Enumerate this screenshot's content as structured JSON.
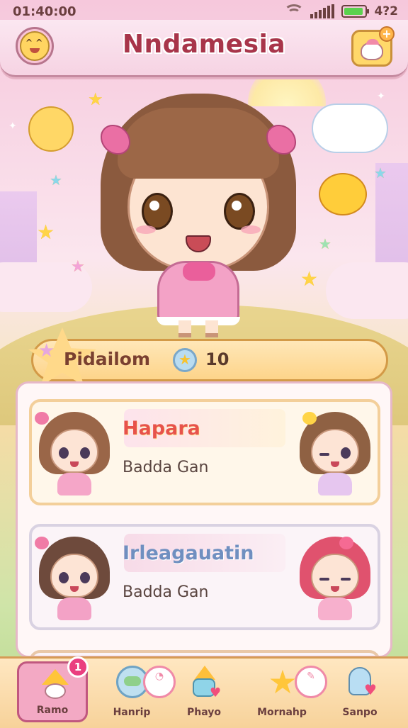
{
  "status_bar": {
    "time": "01:40:00",
    "battery_text": "4?2",
    "battery_level": 0.9
  },
  "header": {
    "title": "Nndamesia",
    "left_icon": "mascot-avatar-icon",
    "right_icon": "mascot-shop-icon"
  },
  "banner": {
    "label": "Pidailom",
    "currency_icon": "star-coin-icon",
    "currency_value": "10"
  },
  "cards": [
    {
      "title": "Hapara",
      "subtitle": "Badda Gan"
    },
    {
      "title": "Irleagauatin",
      "subtitle": "Badda Gan"
    },
    {
      "title": "",
      "subtitle": ""
    }
  ],
  "nav": {
    "items": [
      {
        "label": "Ramo",
        "icon": "home-hat-icon",
        "active": true,
        "badge": "1"
      },
      {
        "label": "Hanrip",
        "icon": "globe-icon",
        "active": false,
        "badge": ""
      },
      {
        "label": "Phayo",
        "icon": "play-cone-icon",
        "active": false,
        "badge": ""
      },
      {
        "label": "Mornahp",
        "icon": "star-icon",
        "active": false,
        "badge": ""
      },
      {
        "label": "Sanpo",
        "icon": "character-icon",
        "active": false,
        "badge": ""
      }
    ]
  },
  "colors": {
    "title": "#a8354a",
    "card1_title": "#e7534a",
    "card2_title": "#6f8fc0",
    "accent_pink": "#f3a9c4",
    "badge": "#ea3f7f"
  }
}
